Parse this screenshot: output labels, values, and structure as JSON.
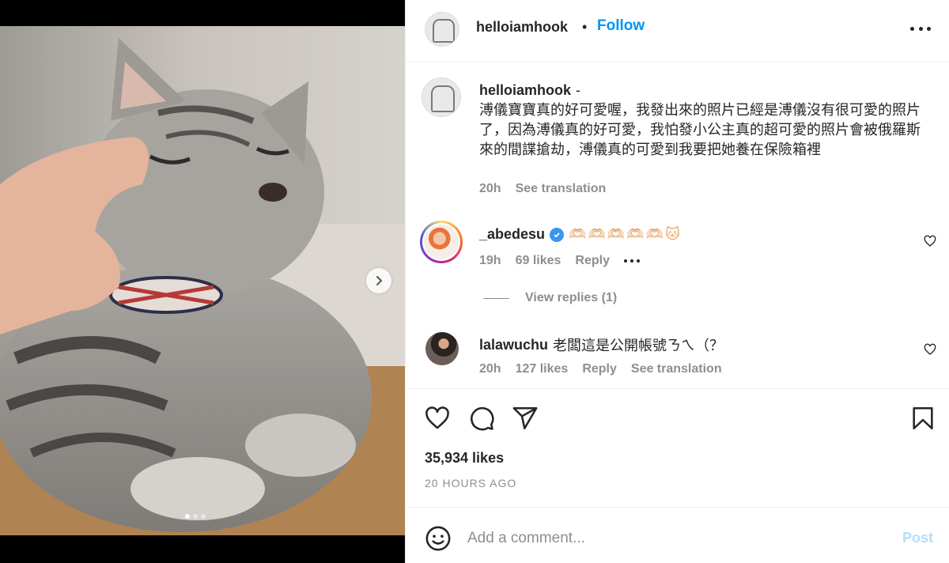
{
  "post": {
    "username": "helloiamhook",
    "follow_label": "Follow",
    "bullet": "•"
  },
  "caption": {
    "username": "helloiamhook",
    "separator": "-",
    "text": "溥儀寶寶真的好可愛喔，我發出來的照片已經是溥儀沒有很可愛的照片了，因為溥儀真的好可愛，我怕發小公主真的超可愛的照片會被俄羅斯來的間諜搶劫，溥儀真的可愛到我要把她養在保險箱裡",
    "time": "20h",
    "translation_label": "See translation"
  },
  "comments": [
    {
      "username": "_abedesu",
      "verified": true,
      "text": "🫶🏻🫶🏻🫶🏻🫶🏻🫶🏻🐱",
      "time": "19h",
      "likes": "69 likes",
      "reply_label": "Reply",
      "view_replies": "View replies (1)"
    },
    {
      "username": "lalawuchu",
      "verified": false,
      "text": "老闆這是公開帳號ㄋㄟ（？",
      "time": "20h",
      "likes": "127 likes",
      "reply_label": "Reply",
      "translation_label": "See translation"
    }
  ],
  "stats": {
    "likes": "35,934 likes",
    "time_ago": "20 HOURS AGO"
  },
  "add_comment": {
    "placeholder": "Add a comment...",
    "post_label": "Post"
  },
  "carousel": {
    "current": 1,
    "total": 3
  },
  "colors": {
    "accent": "#0095f6",
    "muted": "#8e8e8e",
    "post_disabled": "#b2dffc",
    "verified": "#3897f0"
  },
  "icons": [
    "heart-icon",
    "comment-icon",
    "share-icon",
    "bookmark-icon",
    "more-icon",
    "emoji-icon",
    "chevron-right-icon",
    "verified-icon"
  ]
}
